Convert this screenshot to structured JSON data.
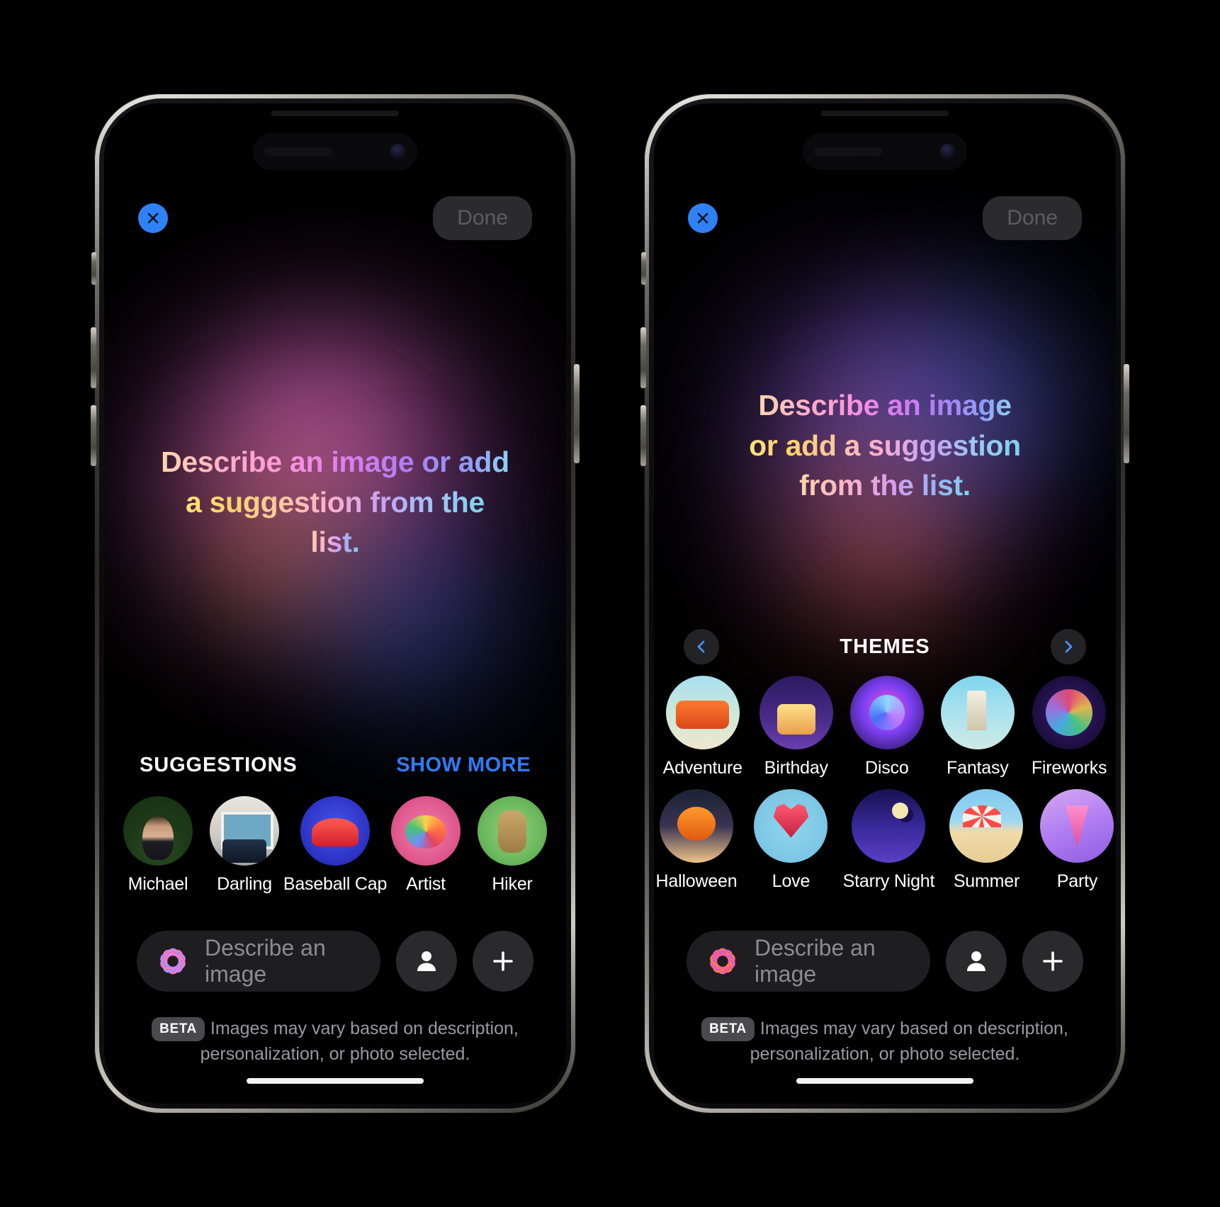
{
  "background_color": "#000000",
  "accent_blue": "#2f7cf6",
  "phones": [
    {
      "id": "left",
      "topbar": {
        "close_icon": "close-icon",
        "done_label": "Done"
      },
      "headline": {
        "line1": "Describe an image or add",
        "line2": "a suggestion from the",
        "line3": "list."
      },
      "section": {
        "title": "SUGGESTIONS",
        "link": "SHOW MORE"
      },
      "suggestions": [
        {
          "label": "Michael",
          "art": "a-michael"
        },
        {
          "label": "Darling",
          "art": "a-darling"
        },
        {
          "label": "Baseball Cap",
          "art": "a-cap"
        },
        {
          "label": "Artist",
          "art": "a-artist"
        },
        {
          "label": "Hiker",
          "art": "a-hiker"
        }
      ],
      "input": {
        "placeholder": "Describe an image",
        "value": "",
        "ai_icon": "apple-intelligence-icon",
        "person_icon": "person-icon",
        "plus_icon": "plus-icon"
      },
      "disclaimer": {
        "badge": "BETA",
        "text": "Images may vary based on description, personalization, or photo selected."
      }
    },
    {
      "id": "right",
      "topbar": {
        "close_icon": "close-icon",
        "done_label": "Done"
      },
      "headline": {
        "line1": "Describe an image",
        "line2": "or add a suggestion",
        "line3": "from the list."
      },
      "themes_header": {
        "title": "THEMES",
        "prev_icon": "chevron-left-icon",
        "next_icon": "chevron-right-icon"
      },
      "themes_row1": [
        {
          "label": "Adventure",
          "art": "a-adventure"
        },
        {
          "label": "Birthday",
          "art": "a-birthday"
        },
        {
          "label": "Disco",
          "art": "a-disco"
        },
        {
          "label": "Fantasy",
          "art": "a-fantasy"
        },
        {
          "label": "Fireworks",
          "art": "a-fireworks"
        }
      ],
      "themes_row2": [
        {
          "label": "Halloween",
          "art": "a-halloween"
        },
        {
          "label": "Love",
          "art": "a-love"
        },
        {
          "label": "Starry Night",
          "art": "a-starry"
        },
        {
          "label": "Summer",
          "art": "a-summer"
        },
        {
          "label": "Party",
          "art": "a-party"
        }
      ],
      "input": {
        "placeholder": "Describe an image",
        "value": "",
        "ai_icon": "apple-intelligence-icon",
        "person_icon": "person-icon",
        "plus_icon": "plus-icon"
      },
      "disclaimer": {
        "badge": "BETA",
        "text": "Images may vary based on description, personalization, or photo selected."
      }
    }
  ]
}
